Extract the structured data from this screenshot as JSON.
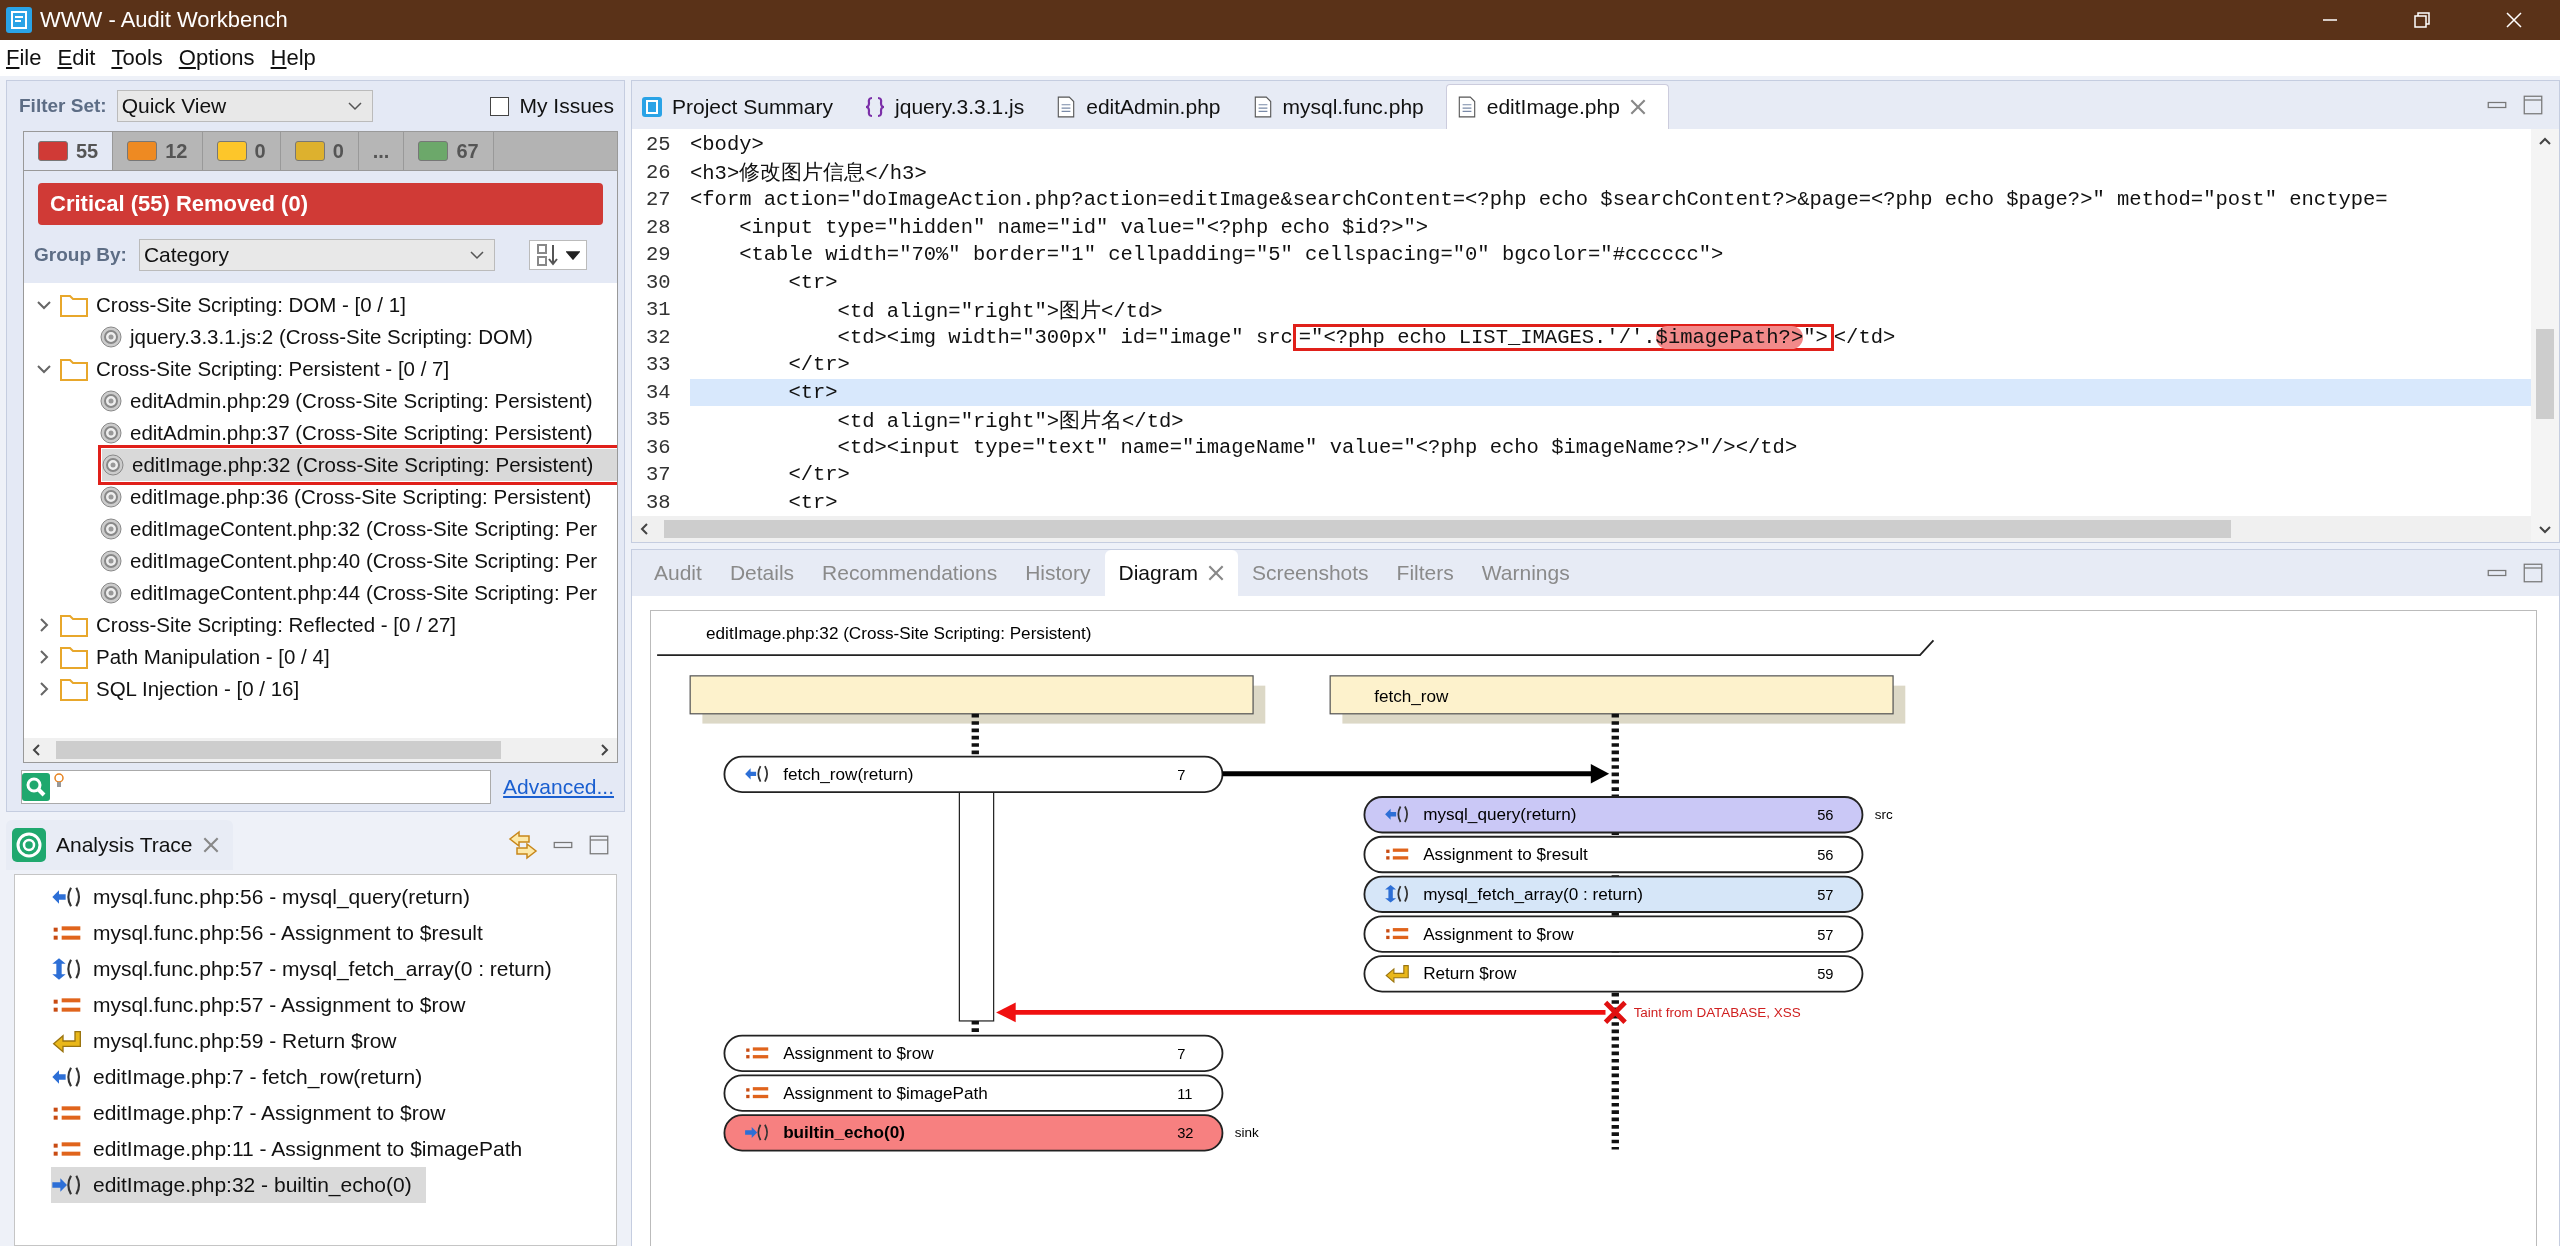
{
  "window": {
    "title": "WWW - Audit Workbench"
  },
  "menu": [
    "File",
    "Edit",
    "Tools",
    "Options",
    "Help"
  ],
  "issues_panel": {
    "filter_label": "Filter Set:",
    "filter_set": "Quick View",
    "my_issues": {
      "label": "My Issues",
      "checked": false
    },
    "severity_tabs": [
      {
        "label": "55",
        "color": "#d03a36",
        "selected": true
      },
      {
        "label": "12",
        "color": "#ee8a22",
        "selected": false
      },
      {
        "label": "0",
        "color": "#fdc62a",
        "selected": false
      },
      {
        "label": "0",
        "color": "#ddb12e",
        "selected": false
      },
      {
        "label": "...",
        "selected": false
      },
      {
        "label": "67",
        "color": "#6ca86a",
        "selected": false
      }
    ],
    "banner": "Critical (55) Removed (0)",
    "group_by_label": "Group By:",
    "group_by": "Category",
    "tree": [
      {
        "label": "Cross-Site Scripting: DOM - [0 / 1]",
        "expanded": true,
        "children": [
          {
            "label": "jquery.3.3.1.js:2 (Cross-Site Scripting: DOM)",
            "selected": false
          }
        ]
      },
      {
        "label": "Cross-Site Scripting: Persistent - [0 / 7]",
        "expanded": true,
        "children": [
          {
            "label": "editAdmin.php:29 (Cross-Site Scripting: Persistent)",
            "selected": false
          },
          {
            "label": "editAdmin.php:37 (Cross-Site Scripting: Persistent)",
            "selected": false
          },
          {
            "label": "editImage.php:32 (Cross-Site Scripting: Persistent)",
            "selected": true,
            "annotated": true
          },
          {
            "label": "editImage.php:36 (Cross-Site Scripting: Persistent)",
            "selected": false
          },
          {
            "label": "editImageContent.php:32 (Cross-Site Scripting: Per",
            "selected": false
          },
          {
            "label": "editImageContent.php:40 (Cross-Site Scripting: Per",
            "selected": false
          },
          {
            "label": "editImageContent.php:44 (Cross-Site Scripting: Per",
            "selected": false
          }
        ]
      },
      {
        "label": "Cross-Site Scripting: Reflected - [0 / 27]",
        "expanded": false
      },
      {
        "label": "Path Manipulation - [0 / 4]",
        "expanded": false
      },
      {
        "label": "SQL Injection - [0 / 16]",
        "expanded": false
      }
    ],
    "advanced_link": "Advanced..."
  },
  "analysis_trace": {
    "title": "Analysis Trace",
    "items": [
      {
        "kind": "call_return",
        "text": "mysql.func.php:56 - mysql_query(return)",
        "selected": false
      },
      {
        "kind": "assignment",
        "text": "mysql.func.php:56 - Assignment to $result",
        "selected": false
      },
      {
        "kind": "call_through",
        "text": "mysql.func.php:57 - mysql_fetch_array(0 : return)",
        "selected": false
      },
      {
        "kind": "assignment",
        "text": "mysql.func.php:57 - Assignment to $row",
        "selected": false
      },
      {
        "kind": "return",
        "text": "mysql.func.php:59 - Return $row",
        "selected": false
      },
      {
        "kind": "call_return",
        "text": "editImage.php:7 - fetch_row(return)",
        "selected": false
      },
      {
        "kind": "assignment",
        "text": "editImage.php:7 - Assignment to $row",
        "selected": false
      },
      {
        "kind": "assignment",
        "text": "editImage.php:11 - Assignment to $imagePath",
        "selected": false
      },
      {
        "kind": "call_out",
        "text": "editImage.php:32 - builtin_echo(0)",
        "selected": true
      }
    ]
  },
  "editor": {
    "tabs": [
      {
        "kind": "summary",
        "label": "Project Summary",
        "selected": false
      },
      {
        "kind": "js",
        "label": "jquery.3.3.1.js",
        "selected": false
      },
      {
        "kind": "php",
        "label": "editAdmin.php",
        "selected": false
      },
      {
        "kind": "php",
        "label": "mysql.func.php",
        "selected": false
      },
      {
        "kind": "php",
        "label": "editImage.php",
        "selected": true
      }
    ],
    "lines": [
      {
        "number": "25",
        "text": "<body>",
        "current": false
      },
      {
        "number": "26",
        "text": "<h3>修改图片信息</h3>",
        "current": false
      },
      {
        "number": "27",
        "text": "<form action=\"doImageAction.php?action=editImage&searchContent=<?php echo $searchContent?>&page=<?php echo $page?>\" method=\"post\" enctype=",
        "current": false
      },
      {
        "number": "28",
        "text": "    <input type=\"hidden\" name=\"id\" value=\"<?php echo $id?>\">",
        "current": false
      },
      {
        "number": "29",
        "text": "    <table width=\"70%\" border=\"1\" cellpadding=\"5\" cellspacing=\"0\" bgcolor=\"#cccccc\">",
        "current": false
      },
      {
        "number": "30",
        "text": "        <tr>",
        "current": false
      },
      {
        "number": "31",
        "text": "            <td align=\"right\">图片</td>",
        "current": false
      },
      {
        "number": "32",
        "text": "            <td><img width=\"300px\" id=\"image\" src",
        "annotation": {
          "text": "=\"<?php echo LIST_IMAGES.'/'.",
          "highlight": "$imagePath?>",
          "after": "\">"
        },
        "rest": "</td>",
        "current": false
      },
      {
        "number": "33",
        "text": "        </tr>",
        "current": false
      },
      {
        "number": "34",
        "text": "        <tr>",
        "current": true
      },
      {
        "number": "35",
        "text": "            <td align=\"right\">图片名</td>",
        "current": false
      },
      {
        "number": "36",
        "text": "            <td><input type=\"text\" name=\"imageName\" value=\"<?php echo $imageName?>\"/></td>",
        "current": false
      },
      {
        "number": "37",
        "text": "        </tr>",
        "current": false
      },
      {
        "number": "38",
        "text": "        <tr>",
        "current": false
      }
    ]
  },
  "detail_tabs": [
    {
      "label": "Audit",
      "selected": false
    },
    {
      "label": "Details",
      "selected": false
    },
    {
      "label": "Recommendations",
      "selected": false
    },
    {
      "label": "History",
      "selected": false
    },
    {
      "label": "Diagram",
      "selected": true
    },
    {
      "label": "Screenshots",
      "selected": false
    },
    {
      "label": "Filters",
      "selected": false
    },
    {
      "label": "Warnings",
      "selected": false
    }
  ],
  "diagram": {
    "title": "editImage.php:32 (Cross-Site Scripting: Persistent)",
    "lanes": [
      {
        "nodes": [
          {
            "kind": "call_return",
            "label": "fetch_row(return)",
            "line": "7",
            "color": "#ffffff"
          },
          {
            "kind": "assignment",
            "label": "Assignment to $row",
            "line": "7",
            "color": "#ffffff"
          },
          {
            "kind": "assignment",
            "label": "Assignment to $imagePath",
            "line": "11",
            "color": "#ffffff"
          },
          {
            "kind": "call_out",
            "label": "builtin_echo(0)",
            "line": "32",
            "color": "#f78080",
            "note": "sink",
            "bold": true
          }
        ]
      },
      {
        "label": "fetch_row",
        "nodes": [
          {
            "kind": "call_return",
            "label": "mysql_query(return)",
            "line": "56",
            "color": "#cac8f6",
            "note": "src"
          },
          {
            "kind": "assignment",
            "label": "Assignment to $result",
            "line": "56",
            "color": "#ffffff"
          },
          {
            "kind": "call_through",
            "label": "mysql_fetch_array(0 : return)",
            "line": "57",
            "color": "#d6e6f8"
          },
          {
            "kind": "assignment",
            "label": "Assignment to $row",
            "line": "57",
            "color": "#ffffff"
          },
          {
            "kind": "return",
            "label": "Return $row",
            "line": "59",
            "color": "#ffffff"
          }
        ]
      }
    ],
    "taint_label": "Taint from DATABASE, XSS"
  }
}
